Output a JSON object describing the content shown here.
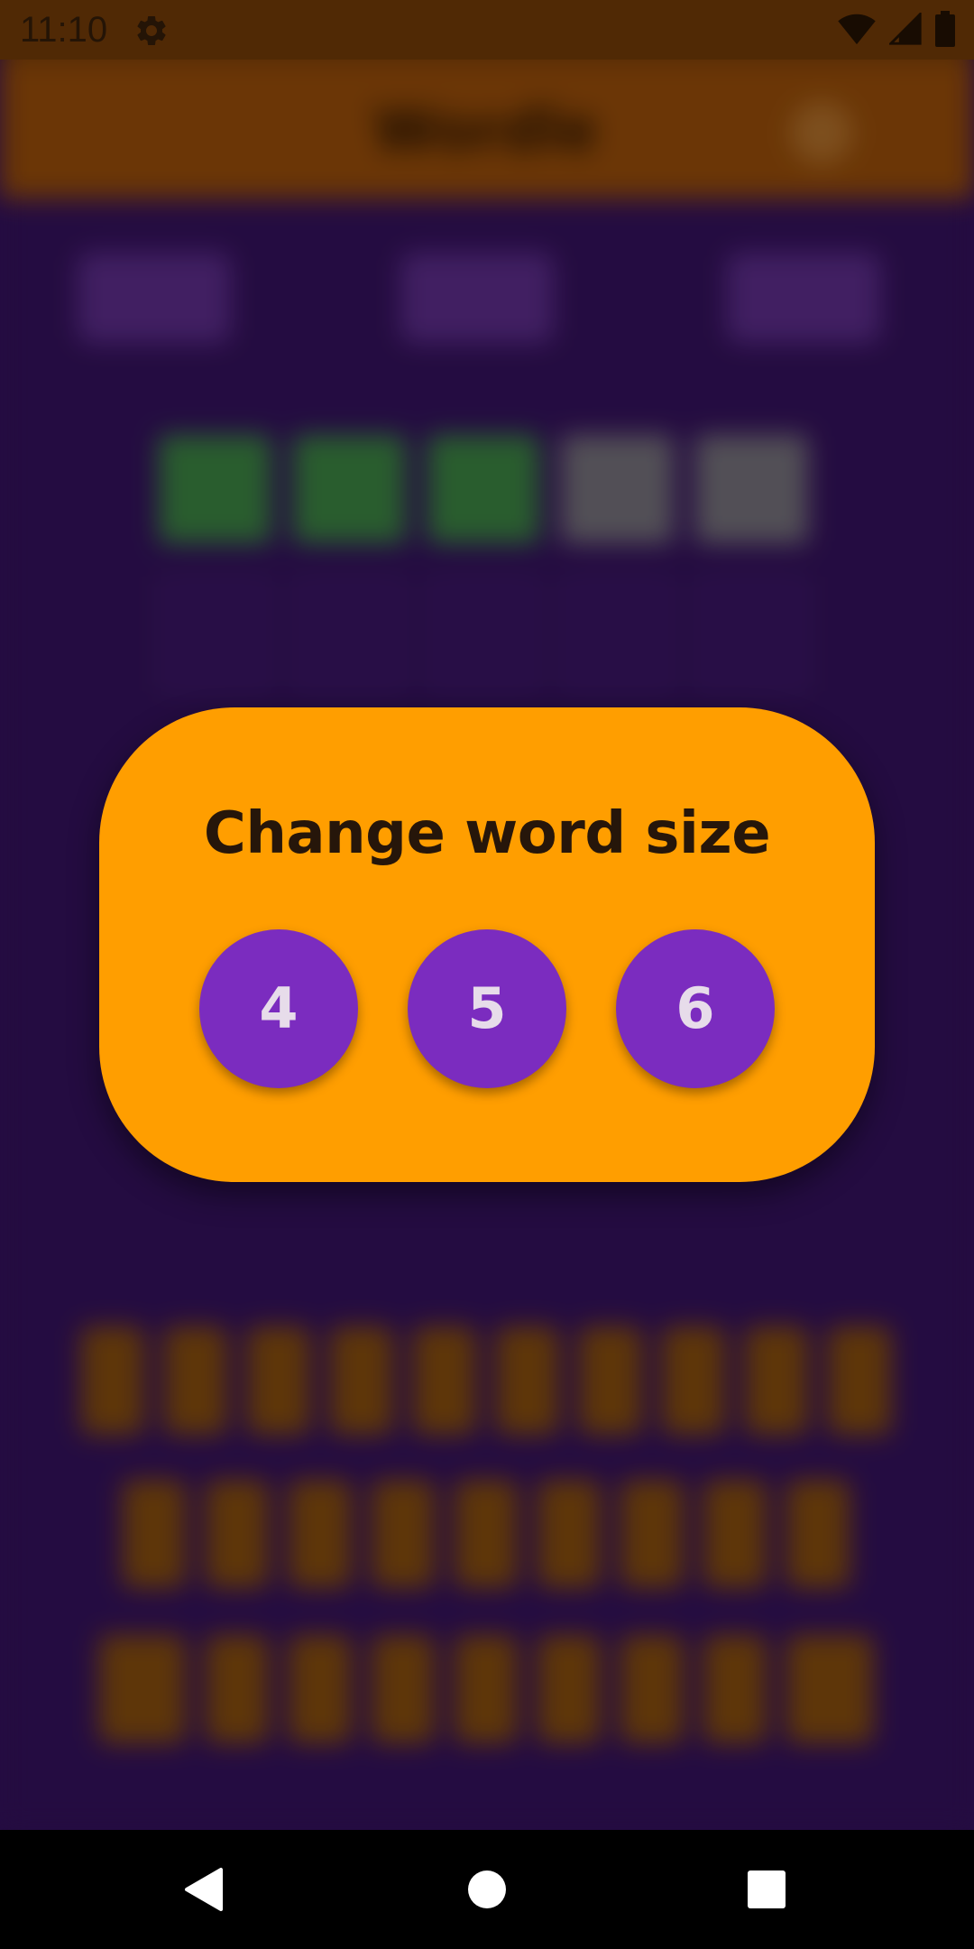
{
  "status_bar": {
    "time": "11:10",
    "icons": [
      "gear-icon",
      "wifi-icon",
      "cell-signal-icon",
      "battery-icon"
    ]
  },
  "background_app": {
    "title": "Wordle"
  },
  "dialog": {
    "title": "Change word size",
    "options": [
      "4",
      "5",
      "6"
    ]
  },
  "nav_bar": {
    "buttons": [
      "back-icon",
      "home-icon",
      "recents-icon"
    ]
  },
  "colors": {
    "dialog_background": "#ff9e00",
    "option_button": "#7b2cbf",
    "app_background": "#2a0e4a",
    "status_bar": "#5c2f06"
  }
}
